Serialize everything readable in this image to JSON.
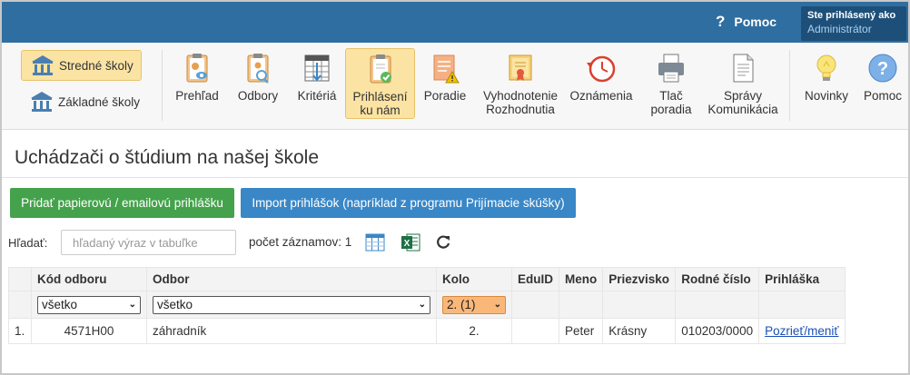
{
  "topbar": {
    "help_label": "Pomoc",
    "help_symbol": "?",
    "user_line1": "Ste prihlásený ako",
    "user_line2": "Administrátor"
  },
  "schools": [
    {
      "label": "Stredné školy",
      "active": true
    },
    {
      "label": "Základné školy",
      "active": false
    }
  ],
  "toolbar": [
    {
      "id": "prehlad",
      "line1": "Prehľad",
      "line2": "",
      "icon": "clipboard-eye-icon"
    },
    {
      "id": "odbory",
      "line1": "Odbory",
      "line2": "",
      "icon": "clipboard-person-icon"
    },
    {
      "id": "kriteria",
      "line1": "Kritériá",
      "line2": "",
      "icon": "grid-table-icon"
    },
    {
      "id": "prihlasenie",
      "line1": "Prihlásení",
      "line2": "ku nám",
      "icon": "clipboard-check-icon",
      "active": true
    },
    {
      "id": "poradie",
      "line1": "Poradie",
      "line2": "",
      "icon": "document-warning-icon"
    },
    {
      "id": "vyhodnotenie",
      "line1": "Vyhodnotenie",
      "line2": "Rozhodnutia",
      "icon": "certificate-icon"
    },
    {
      "id": "oznamenia",
      "line1": "Oznámenia",
      "line2": "",
      "icon": "clock-back-icon"
    },
    {
      "id": "tlac",
      "line1": "Tlač",
      "line2": "poradia",
      "icon": "printer-icon"
    },
    {
      "id": "spravy",
      "line1": "Správy",
      "line2": "Komunikácia",
      "icon": "document-icon"
    },
    {
      "id": "novinky",
      "line1": "Novinky",
      "line2": "",
      "icon": "lightbulb-icon"
    },
    {
      "id": "pomoc",
      "line1": "Pomoc",
      "line2": "",
      "icon": "question-circle-icon"
    }
  ],
  "page": {
    "title": "Uchádzači o štúdium na našej škole"
  },
  "buttons": {
    "paper": "Pridať papierovú / emailovú prihlášku",
    "import": "Import prihlášok (napríklad z programu Prijímacie skúšky)"
  },
  "search": {
    "label": "Hľadať:",
    "placeholder": "hľadaný výraz v tabuľke",
    "count_text": "počet záznamov: 1"
  },
  "table": {
    "headers": [
      "Kód odboru",
      "Odbor",
      "Kolo",
      "EduID",
      "Meno",
      "Priezvisko",
      "Rodné číslo",
      "Prihláška"
    ],
    "filters": {
      "kod": "všetko",
      "odbor": "všetko",
      "kolo": "2. (1)"
    },
    "rows": [
      {
        "num": "1.",
        "kod": "4571H00",
        "odbor": "záhradník",
        "kolo": "2.",
        "eduid": "",
        "meno": "Peter",
        "priezvisko": "Krásny",
        "rodne": "010203/0000",
        "link": "Pozrieť/meniť"
      }
    ]
  },
  "colors": {
    "topbar": "#2f6ea0",
    "green": "#45a24c",
    "blue": "#3a87c7",
    "highlight": "#fbe3a3",
    "orange": "#f9b77a"
  }
}
